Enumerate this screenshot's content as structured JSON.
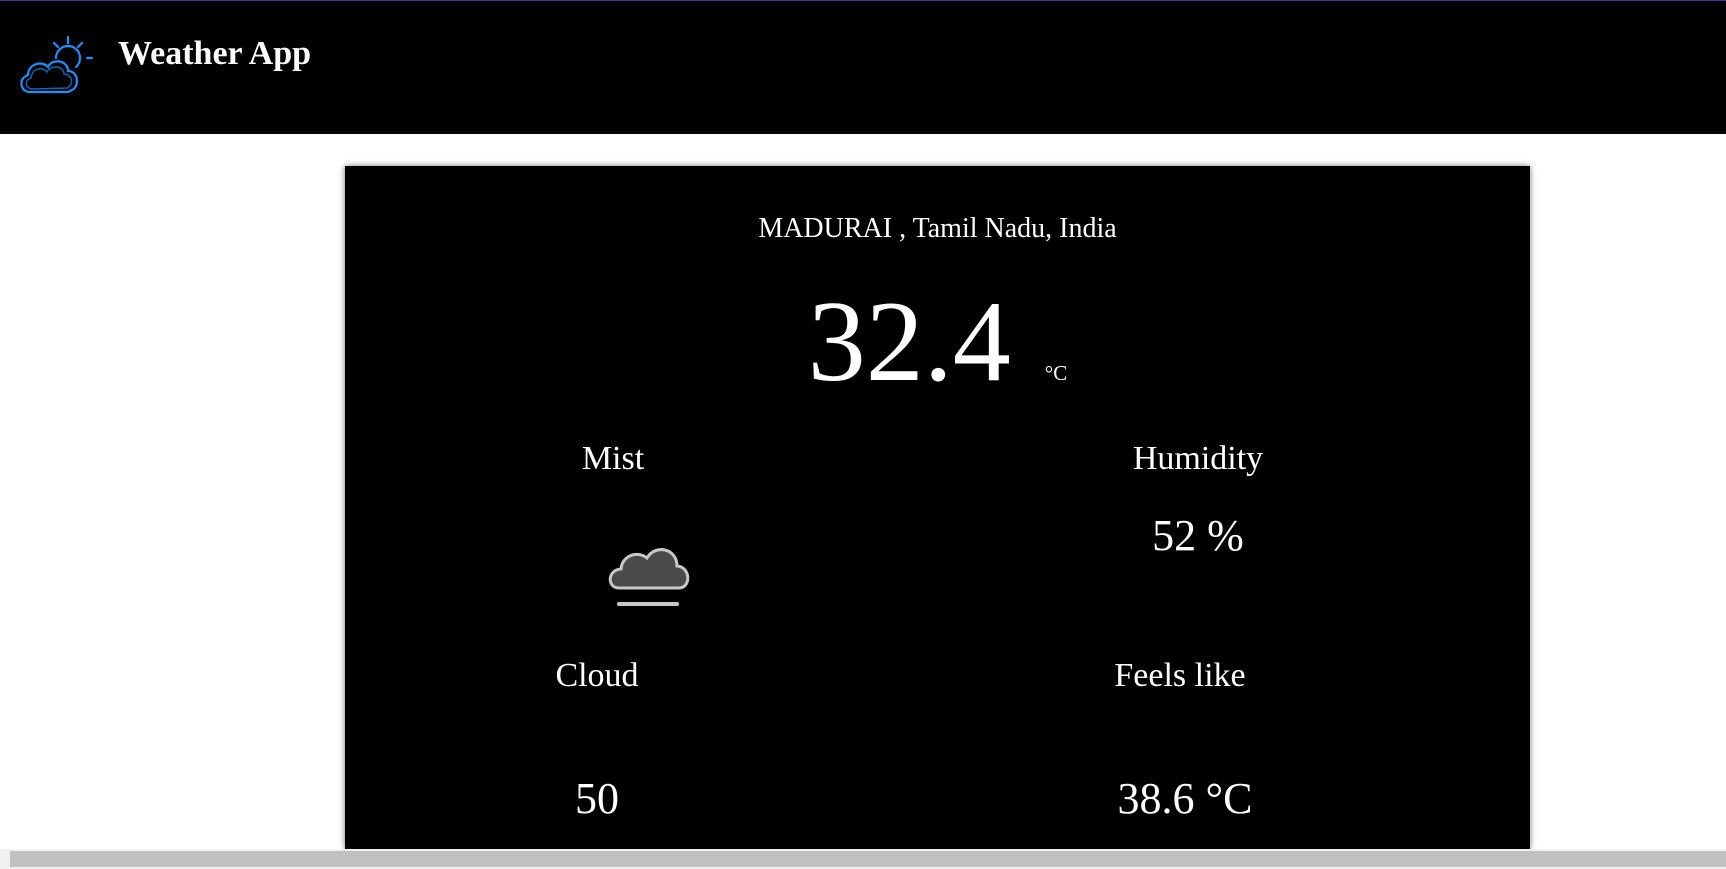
{
  "header": {
    "title": "Weather App",
    "logo_icon": "cloud-sun-icon",
    "background": "#000000",
    "accent": "#1e90ff"
  },
  "weather": {
    "location": "MADURAI , Tamil Nadu, India",
    "temperature": "32.4",
    "temperature_unit": "°C",
    "condition": "Mist",
    "condition_icon": "mist-cloud-icon",
    "humidity_label": "Humidity",
    "humidity_value": "52 %",
    "cloud_label": "Cloud",
    "cloud_value": "50",
    "feels_like_label": "Feels like",
    "feels_like_value": "38.6 °C"
  },
  "colors": {
    "card_background": "#000000",
    "text": "#ffffff",
    "page_background": "#ffffff"
  }
}
